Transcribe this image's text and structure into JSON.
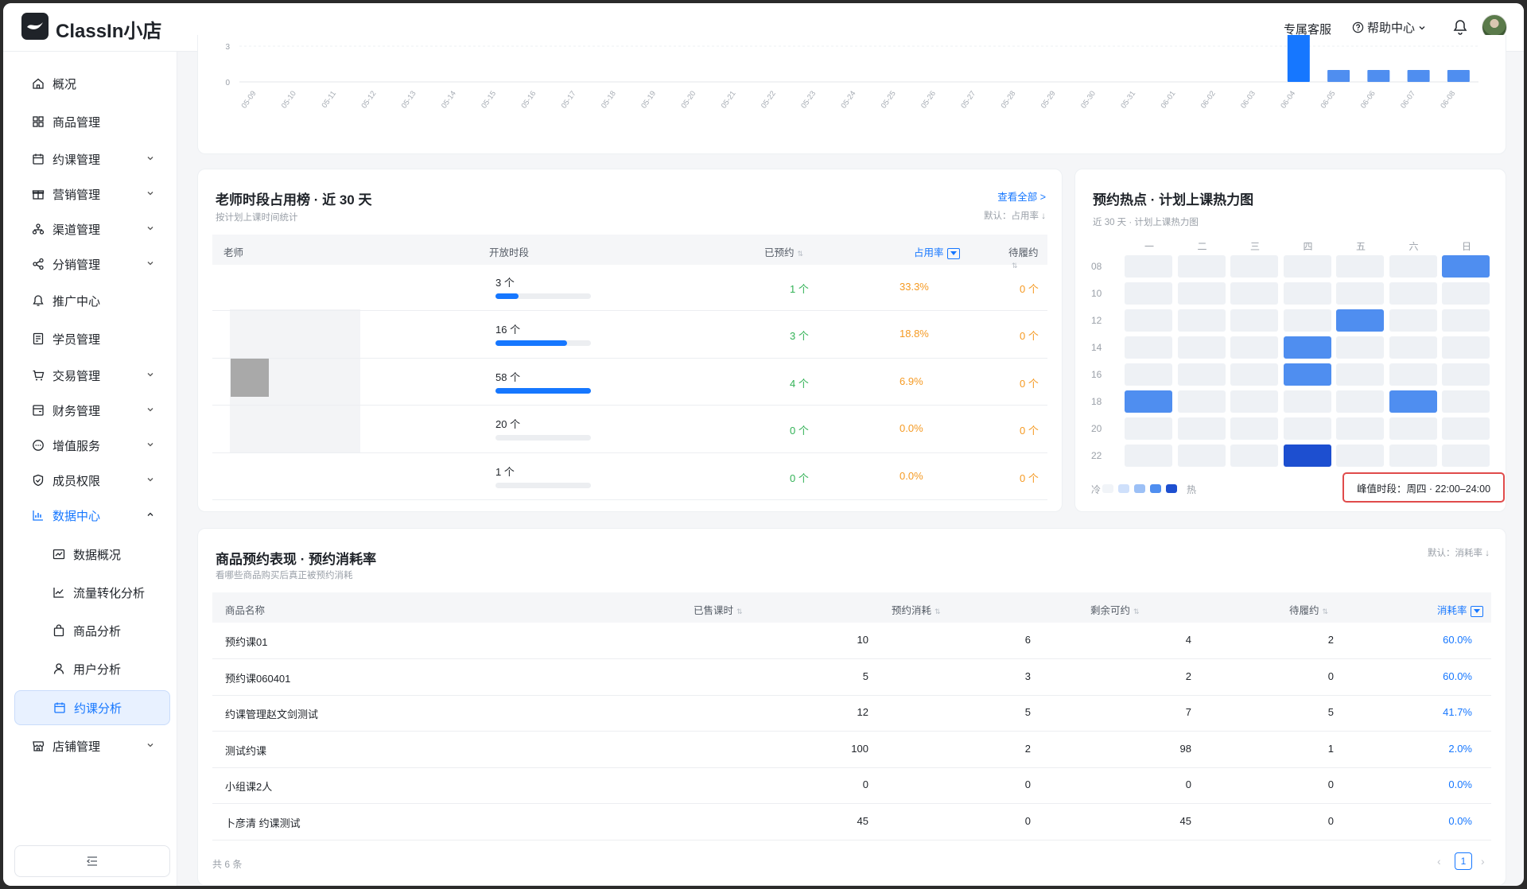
{
  "header": {
    "app_name": "ClassIn小店",
    "support": "专属客服",
    "help": "帮助中心"
  },
  "sidebar": {
    "items": [
      {
        "label": "概况",
        "icon": "home-icon"
      },
      {
        "label": "商品管理",
        "icon": "grid-icon"
      },
      {
        "label": "约课管理",
        "icon": "calendar-icon"
      },
      {
        "label": "营销管理",
        "icon": "gift-icon"
      },
      {
        "label": "渠道管理",
        "icon": "channel-icon"
      },
      {
        "label": "分销管理",
        "icon": "share-icon"
      },
      {
        "label": "推广中心",
        "icon": "bell-icon"
      },
      {
        "label": "学员管理",
        "icon": "student-icon"
      },
      {
        "label": "交易管理",
        "icon": "cart-icon"
      },
      {
        "label": "财务管理",
        "icon": "finance-icon"
      },
      {
        "label": "增值服务",
        "icon": "chat-icon"
      },
      {
        "label": "成员权限",
        "icon": "shield-icon"
      },
      {
        "label": "数据中心",
        "icon": "chart-icon"
      },
      {
        "label": "数据概况",
        "icon": "trend-icon"
      },
      {
        "label": "流量转化分析",
        "icon": "line-chart-icon"
      },
      {
        "label": "商品分析",
        "icon": "bag-icon"
      },
      {
        "label": "用户分析",
        "icon": "user-icon"
      },
      {
        "label": "约课分析",
        "icon": "calendar-icon"
      },
      {
        "label": "店铺管理",
        "icon": "store-icon"
      }
    ]
  },
  "top_chart": {
    "chart_data": {
      "type": "bar",
      "categories": [
        "05-09",
        "05-10",
        "05-11",
        "05-12",
        "05-13",
        "05-14",
        "05-15",
        "05-16",
        "05-17",
        "05-18",
        "05-19",
        "05-20",
        "05-21",
        "05-22",
        "05-23",
        "05-24",
        "05-25",
        "05-26",
        "05-27",
        "05-28",
        "05-29",
        "05-30",
        "05-31",
        "06-01",
        "06-02",
        "06-03",
        "06-04",
        "06-05",
        "06-06",
        "06-07",
        "06-08"
      ],
      "values": [
        0,
        0,
        0,
        0,
        0,
        0,
        0,
        0,
        0,
        0,
        0,
        0,
        0,
        0,
        0,
        0,
        0,
        0,
        0,
        0,
        0,
        0,
        0,
        0,
        0,
        0,
        6,
        1,
        1,
        1,
        1
      ],
      "y_ticks": [
        "3",
        "0"
      ],
      "grid": true
    }
  },
  "teacher_card": {
    "title": "老师时段占用榜 · 近 30 天",
    "subtitle": "按计划上课时间统计",
    "view_all": "查看全部 >",
    "default_sort": "默认：占用率 ↓",
    "columns": {
      "teacher": "老师",
      "slots": "开放时段",
      "booked": "已预约",
      "rate": "占用率",
      "pending": "待履约"
    },
    "rows": [
      {
        "slots": "3 个",
        "booked": "1 个",
        "rate": "33.3%",
        "pending": "0 个",
        "fill": 0.24
      },
      {
        "slots": "16 个",
        "booked": "3 个",
        "rate": "18.8%",
        "pending": "0 个",
        "fill": 0.75
      },
      {
        "slots": "58 个",
        "booked": "4 个",
        "rate": "6.9%",
        "pending": "0 个",
        "fill": 1.0
      },
      {
        "slots": "20 个",
        "booked": "0 个",
        "rate": "0.0%",
        "pending": "0 个",
        "fill": 0.0
      },
      {
        "slots": "1 个",
        "booked": "0 个",
        "rate": "0.0%",
        "pending": "0 个",
        "fill": 0.0
      }
    ]
  },
  "heatmap_card": {
    "title": "预约热点 · 计划上课热力图",
    "subtitle": "近 30 天 · 计划上课热力图",
    "days": [
      "一",
      "二",
      "三",
      "四",
      "五",
      "六",
      "日"
    ],
    "hours": [
      "08",
      "10",
      "12",
      "14",
      "16",
      "18",
      "20",
      "22"
    ],
    "cells": [
      [
        0,
        0,
        0,
        0,
        0,
        0,
        3
      ],
      [
        0,
        0,
        0,
        0,
        0,
        0,
        0
      ],
      [
        0,
        0,
        0,
        0,
        3,
        0,
        0
      ],
      [
        0,
        0,
        0,
        3,
        0,
        0,
        0
      ],
      [
        0,
        0,
        0,
        3,
        0,
        0,
        0
      ],
      [
        3,
        0,
        0,
        0,
        0,
        3,
        0
      ],
      [
        0,
        0,
        0,
        0,
        0,
        0,
        0
      ],
      [
        0,
        0,
        0,
        4,
        0,
        0,
        0
      ]
    ],
    "legend_cold": "冷",
    "legend_hot": "热",
    "peak": "峰值时段：周四 · 22:00–24:00",
    "colors": {
      "0": "#eef1f5",
      "1": "#cfe0fb",
      "2": "#9cc0f6",
      "3": "#4f8ef0",
      "4": "#1d4fd0"
    }
  },
  "product_card": {
    "title": "商品预约表现 · 预约消耗率",
    "subtitle": "看哪些商品购买后真正被预约消耗",
    "default_sort": "默认：消耗率 ↓",
    "columns": {
      "name": "商品名称",
      "sold": "已售课时",
      "consumed": "预约消耗",
      "remaining": "剩余可约",
      "pending": "待履约",
      "rate": "消耗率"
    },
    "rows": [
      {
        "name": "预约课01",
        "sold": "10",
        "consumed": "6",
        "remaining": "4",
        "pending": "2",
        "rate": "60.0%"
      },
      {
        "name": "预约课060401",
        "sold": "5",
        "consumed": "3",
        "remaining": "2",
        "pending": "0",
        "rate": "60.0%"
      },
      {
        "name": "约课管理赵文剑测试",
        "sold": "12",
        "consumed": "5",
        "remaining": "7",
        "pending": "5",
        "rate": "41.7%"
      },
      {
        "name": "测试约课",
        "sold": "100",
        "consumed": "2",
        "remaining": "98",
        "pending": "1",
        "rate": "2.0%"
      },
      {
        "name": "小组课2人",
        "sold": "0",
        "consumed": "0",
        "remaining": "0",
        "pending": "0",
        "rate": "0.0%"
      },
      {
        "name": "卜彦清 约课测试",
        "sold": "45",
        "consumed": "0",
        "remaining": "45",
        "pending": "0",
        "rate": "0.0%"
      }
    ],
    "total": "共 6 条",
    "page": "1"
  }
}
